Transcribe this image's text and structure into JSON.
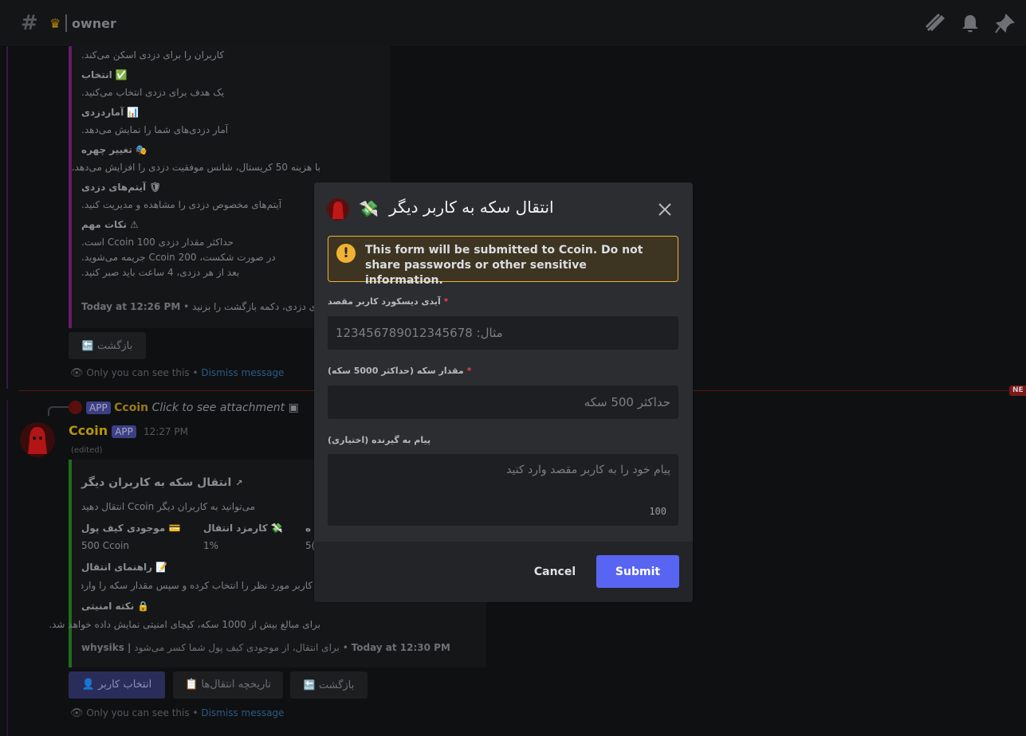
{
  "header": {
    "channel": "owner"
  },
  "bg_embed1": {
    "lines": [
      {
        "kind": "desc",
        "text": "کاربران را برای دزدی اسکن می‌کند."
      },
      {
        "kind": "head",
        "text": "انتخاب",
        "emoji": "✅"
      },
      {
        "kind": "desc",
        "text": "یک هدف برای دزدی انتخاب می‌کنید."
      },
      {
        "kind": "head",
        "text": "آماردزدی",
        "emoji": "📊"
      },
      {
        "kind": "desc",
        "text": "آمار دزدی‌های شما را نمایش می‌دهد."
      },
      {
        "kind": "head",
        "text": "تغییر چهره",
        "emoji": "🎭"
      },
      {
        "kind": "desc",
        "text": "با هزینه 50 کریستال، شانس موفقیت دزدی را افزایش می‌دهد."
      },
      {
        "kind": "head",
        "text": "آیتم‌های دزدی",
        "emoji": "🛡"
      },
      {
        "kind": "desc",
        "text": "آیتم‌های مخصوص دزدی را مشاهده و مدیریت کنید."
      },
      {
        "kind": "head",
        "text": "نکات مهم",
        "emoji": "⚠"
      },
      {
        "kind": "desc",
        "text": "حداکثر مقدار دزدی 100 Ccoin است."
      },
      {
        "kind": "desc",
        "text": "در صورت شکست، 200 Ccoin جریمه می‌شوید."
      },
      {
        "kind": "desc",
        "text": "بعد از هر دزدی، 4 ساعت باید صبر کنید."
      }
    ],
    "footer_time": "Today at 12:26 PM",
    "footer_note": "برای بازگشت به منوی دزدی، دکمه بازگشت را بزنید.",
    "back_button": "بازگشت"
  },
  "ephemeral1": {
    "note": "Only you can see this",
    "sep": "•",
    "dismiss": "Dismiss message"
  },
  "new_tag": "NE",
  "reply": {
    "app": "APP",
    "name": "Ccoin",
    "text": "Click to see attachment"
  },
  "msg": {
    "author": "Ccoin",
    "app": "APP",
    "time": "12:27 PM",
    "edited": "(edited)"
  },
  "bg_embed2": {
    "title": "انتقال سکه به کاربران دیگر",
    "desc": "می‌توانید به کاربران دیگر Ccoin انتقال دهید",
    "fields": [
      {
        "name": "موجودی کیف پول",
        "emoji": "💳",
        "value": "500 Ccoin"
      },
      {
        "name": "کارمزد انتقال",
        "emoji": "💸",
        "value": "1%"
      },
      {
        "name": "ه",
        "emoji": "",
        "value": "5("
      }
    ],
    "guide_title": "راهنمای انتقال",
    "guide_desc": "کاربر مورد نظر را انتخاب کرده و سپس مقدار سکه را وارد کنید.",
    "security_title": "نکته امنیتی",
    "security_desc": "برای مبالغ بیش از 1000 سکه، کپچای امنیتی نمایش داده خواهد شد.",
    "footer_user": "whysiks |",
    "footer_note": "برای انتقال، از موجودی کیف پول شما کسر می‌شود",
    "footer_time": "Today at 12:30 PM"
  },
  "buttons2": {
    "select_user": "انتخاب کاربر",
    "history": "تاریخچه انتقال‌ها",
    "back": "بازگشت"
  },
  "ephemeral2": {
    "note": "Only you can see this",
    "sep": "•",
    "dismiss": "Dismiss message"
  },
  "modal": {
    "title": "انتقال سکه به کاربر دیگر",
    "warning": "This form will be submitted to Ccoin. Do not share passwords or other sensitive information.",
    "fields": [
      {
        "label": "آیدی دیسکورد کاربر مقصد",
        "required": "*",
        "placeholder": "مثال: 123456789012345678"
      },
      {
        "label": "مقدار سکه (حداکثر 5000 سکه)",
        "required": "*",
        "placeholder": "حداکثر 500 سکه"
      },
      {
        "label": "پیام به گیرنده (اختیاری)",
        "placeholder": "پیام خود را به کاربر مقصد وارد کنید",
        "counter": "100"
      }
    ],
    "cancel": "Cancel",
    "submit": "Submit"
  },
  "colors": {
    "accent": "#5865f2",
    "warning": "#f0b232",
    "danger": "#f23f43"
  }
}
